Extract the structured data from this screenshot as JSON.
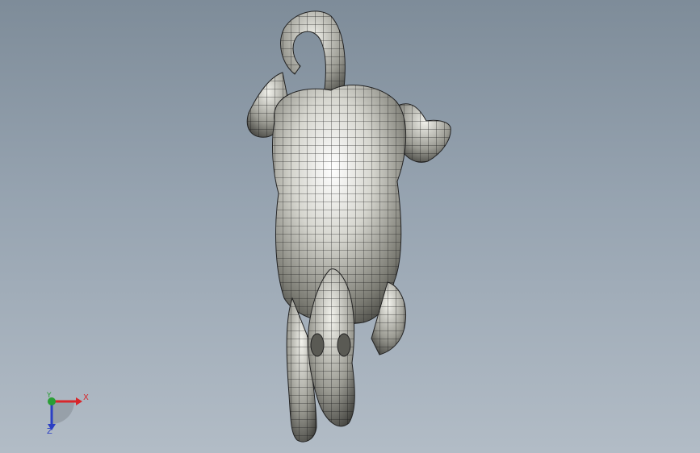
{
  "viewport": {
    "background_top": "#7e8c99",
    "background_bottom": "#b2bcc6",
    "model_name": "",
    "model_color": "#d9d9d9",
    "mesh_color": "#1a1a1a"
  },
  "triad": {
    "x_label": "X",
    "y_label": "Y",
    "z_label": "Z",
    "x_color": "#d8262a",
    "y_color": "#2a9e35",
    "z_color": "#2b3fc4"
  }
}
